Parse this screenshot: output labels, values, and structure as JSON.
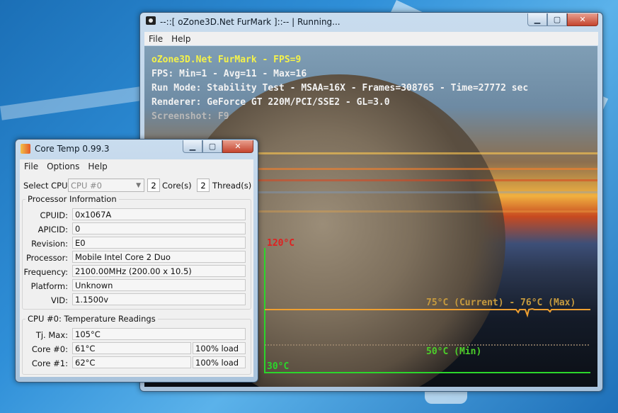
{
  "furmark": {
    "title": "--::[ oZone3D.Net FurMark ]::-- | Running...",
    "menu": [
      "File",
      "Help"
    ],
    "overlay": {
      "line1": "oZone3D.Net FurMark - FPS=9",
      "line2": "FPS: Min=1 - Avg=11 - Max=16",
      "line3": "Run Mode: Stability Test - MSAA=16X - Frames=308765 - Time=27772 sec",
      "line4": "Renderer: GeForce GT 220M/PCI/SSE2 - GL=3.0",
      "line5": "Screenshot: F9"
    },
    "graph": {
      "max_label": "120°C",
      "min_label": "30°C",
      "current_label": "75°C (Current) - 76°C (Max)",
      "min_temp_label": "50°C (Min)",
      "colors": {
        "max": "#e02020",
        "axis": "#2bd62b",
        "current": "#f0a030",
        "min": "#4ccf2a"
      }
    }
  },
  "coretemp": {
    "title": "Core Temp 0.99.3",
    "menu": [
      "File",
      "Options",
      "Help"
    ],
    "select_cpu_label": "Select CPU:",
    "select_cpu_value": "CPU #0",
    "cores_value": "2",
    "cores_label": "Core(s)",
    "threads_value": "2",
    "threads_label": "Thread(s)",
    "processor_group": "Processor Information",
    "info": [
      {
        "label": "CPUID:",
        "value": "0x1067A"
      },
      {
        "label": "APICID:",
        "value": "0"
      },
      {
        "label": "Revision:",
        "value": "E0"
      },
      {
        "label": "Processor:",
        "value": "Mobile Intel Core 2 Duo"
      },
      {
        "label": "Frequency:",
        "value": "2100.00MHz (200.00 x 10.5)"
      },
      {
        "label": "Platform:",
        "value": "Unknown"
      },
      {
        "label": "VID:",
        "value": "1.1500v"
      }
    ],
    "temp_group": "CPU #0: Temperature Readings",
    "tjmax_label": "Tj. Max:",
    "tjmax_value": "105°C",
    "cores": [
      {
        "label": "Core #0:",
        "temp": "61°C",
        "load": "100% load"
      },
      {
        "label": "Core #1:",
        "temp": "62°C",
        "load": "100% load"
      }
    ]
  }
}
